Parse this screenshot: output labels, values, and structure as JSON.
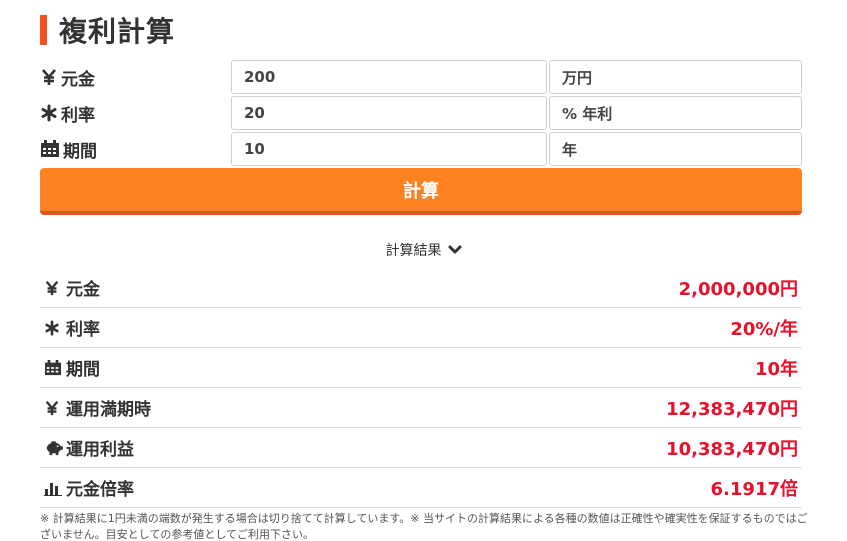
{
  "header": {
    "title": "複利計算"
  },
  "form": {
    "principal": {
      "label": "元金",
      "value": "200",
      "unit": "万円",
      "icon": "yen-icon"
    },
    "rate": {
      "label": "利率",
      "value": "20",
      "unit": "% 年利",
      "icon": "asterisk-icon"
    },
    "period": {
      "label": "期間",
      "value": "10",
      "unit": "年",
      "icon": "calendar-icon"
    },
    "submit_label": "計算"
  },
  "results": {
    "toggle_label": "計算結果",
    "rows": [
      {
        "label": "元金",
        "value": "2,000,000円",
        "icon": "yen-icon"
      },
      {
        "label": "利率",
        "value": "20%/年",
        "icon": "asterisk-icon"
      },
      {
        "label": "期間",
        "value": "10年",
        "icon": "calendar-icon"
      },
      {
        "label": "運用満期時",
        "value": "12,383,470円",
        "icon": "yen-icon"
      },
      {
        "label": "運用利益",
        "value": "10,383,470円",
        "icon": "piggy-bank-icon"
      },
      {
        "label": "元金倍率",
        "value": "6.1917倍",
        "icon": "bar-chart-icon"
      }
    ]
  },
  "note": "※ 計算結果に1円未満の端数が発生する場合は切り捨てて計算しています。※ 当サイトの計算結果による各種の数値は正確性や確実性を保証するものではございません。目安としての参考値としてご利用下さい。",
  "colors": {
    "accent": "#ff8222",
    "title_bar": "#f4511e",
    "result_value": "#e8102a"
  }
}
